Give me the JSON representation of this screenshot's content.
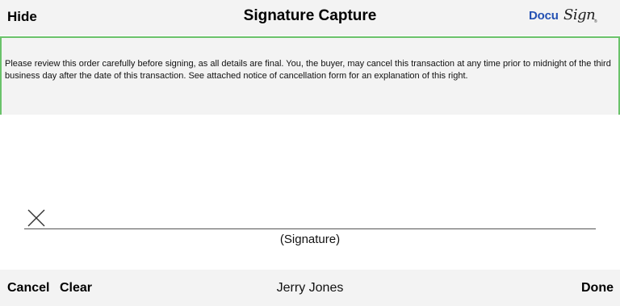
{
  "header": {
    "hide_label": "Hide",
    "title": "Signature Capture",
    "logo": {
      "docu": "Docu",
      "sign": "Sign",
      "reg": "®"
    }
  },
  "notice": {
    "text": "Please review this order carefully before signing, as all details are final. You, the buyer, may cancel this transaction at any time prior to midnight of the third business day after the date of this transaction. See attached notice of cancellation form for an explanation of this right.",
    "border_color": "#6ac26a"
  },
  "signature_area": {
    "x_icon": "x-mark-icon",
    "label": "(Signature)"
  },
  "footer": {
    "cancel_label": "Cancel",
    "clear_label": "Clear",
    "signer_name": "Jerry Jones",
    "done_label": "Done"
  }
}
